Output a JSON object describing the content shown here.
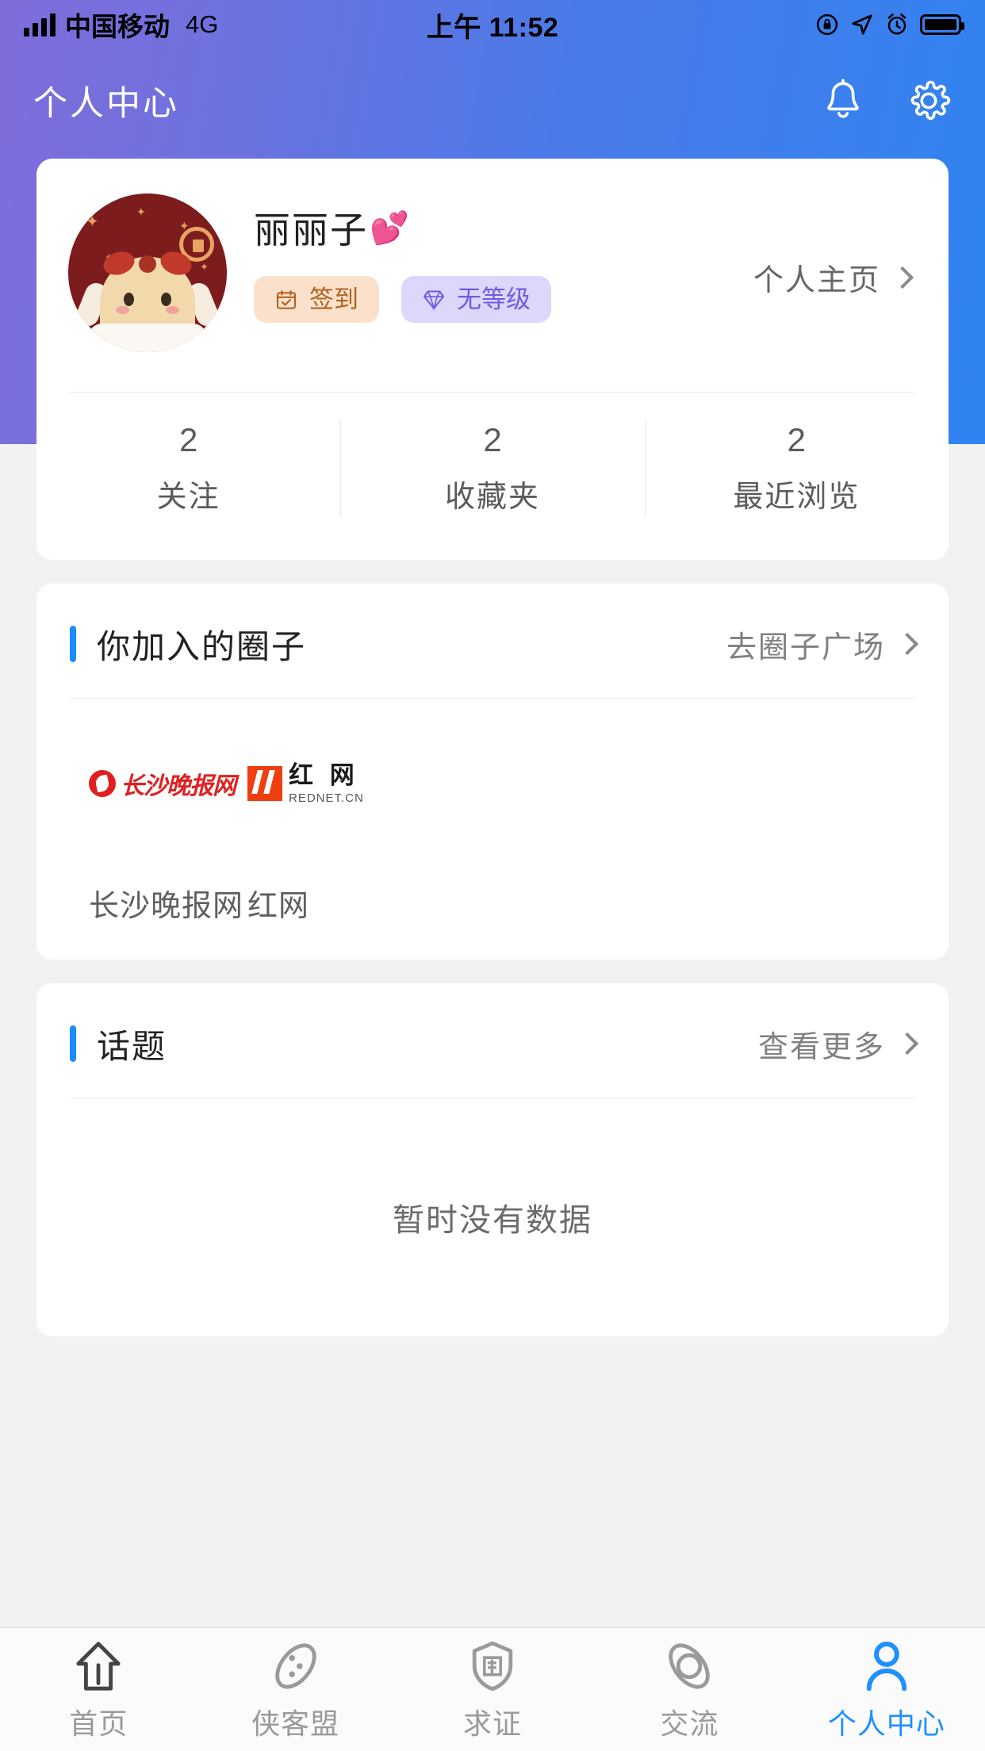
{
  "status_bar": {
    "carrier": "中国移动",
    "network": "4G",
    "time": "上午 11:52",
    "signal_icon": "signal-bars-icon",
    "lock_icon": "rotation-lock-icon",
    "location_icon": "location-arrow-icon",
    "alarm_icon": "alarm-clock-icon",
    "battery_icon": "battery-full-icon"
  },
  "header": {
    "title": "个人中心",
    "bell_icon": "bell-icon",
    "gear_icon": "gear-icon",
    "gradient_from": "#7f6ddb",
    "gradient_to": "#2f84f2"
  },
  "profile": {
    "username": "丽丽子",
    "username_emoji": "💕",
    "avatar_name": "user-avatar",
    "badges": [
      {
        "label": "签到",
        "icon": "calendar-check-icon",
        "bg": "#fbe1cb",
        "color": "#b06321"
      },
      {
        "label": "无等级",
        "icon": "diamond-icon",
        "bg": "#ddd7fb",
        "color": "#6c5ce7"
      }
    ],
    "homepage_link": "个人主页",
    "stats": [
      {
        "value": "2",
        "label": "关注"
      },
      {
        "value": "2",
        "label": "收藏夹"
      },
      {
        "value": "2",
        "label": "最近浏览"
      }
    ]
  },
  "circles_section": {
    "title": "你加入的圈子",
    "more_label": "去圈子广场",
    "accent_color": "#1a8cff",
    "items": [
      {
        "name": "长沙晚报网",
        "logo": "changsha-evening-news-logo",
        "logo_color": "#e02020"
      },
      {
        "name": "红网",
        "logo": "rednet-logo",
        "logo_text_cn": "红 网",
        "logo_text_en": "REDNET.CN",
        "logo_color": "#ef3e10"
      }
    ]
  },
  "topics_section": {
    "title": "话题",
    "more_label": "查看更多",
    "accent_color": "#1a8cff",
    "empty_text": "暂时没有数据"
  },
  "tabbar": {
    "active_color": "#1e90ff",
    "inactive_color": "#9a9a9a",
    "items": [
      {
        "label": "首页",
        "icon": "home-arrow-icon",
        "active": false
      },
      {
        "label": "侠客盟",
        "icon": "palette-icon",
        "active": false
      },
      {
        "label": "求证",
        "icon": "shield-verify-icon",
        "active": false
      },
      {
        "label": "交流",
        "icon": "aperture-icon",
        "active": false
      },
      {
        "label": "个人中心",
        "icon": "person-icon",
        "active": true
      }
    ]
  }
}
